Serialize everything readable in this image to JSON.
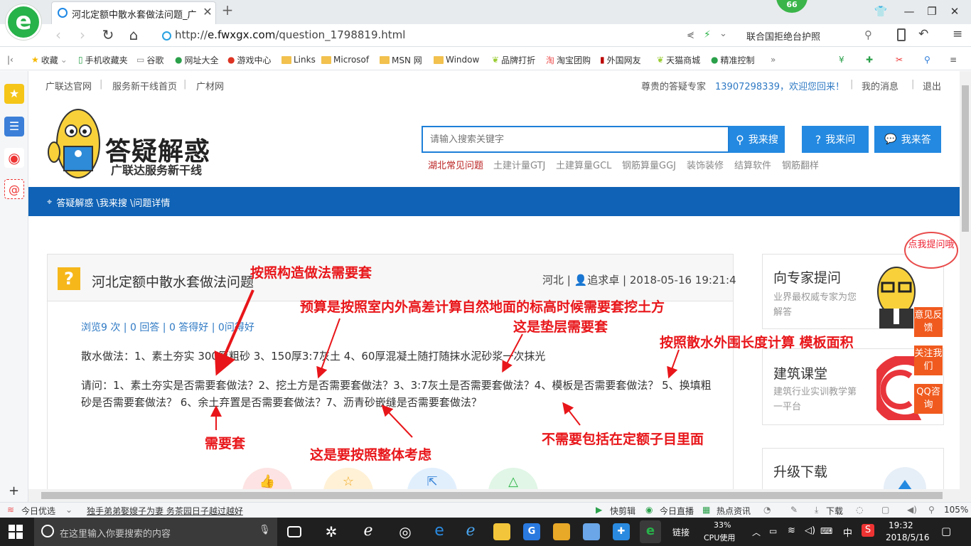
{
  "browser": {
    "tab_title": "河北定额中散水套做法问题_广联",
    "badge": "66",
    "url_prefix": "http://",
    "url_domain": "e.fwxgx.com",
    "url_path": "/question_1798819.html",
    "search_suggestion": "联合国拒绝台护照"
  },
  "bookmarks": [
    "收藏",
    "手机收藏夹",
    "谷歌",
    "网址大全",
    "游戏中心",
    "Links",
    "Microsof",
    "MSN 网",
    "Window",
    "品牌打折",
    "淘宝团购",
    "外国网友",
    "天猫商城",
    "精准控制"
  ],
  "site": {
    "top_links": [
      "广联达官网",
      "服务新干线首页",
      "广材网"
    ],
    "user_role": "尊贵的答疑专家",
    "user_phone": "13907298339，欢迎您回来！",
    "messages": "我的消息",
    "logout": "退出",
    "logo_title": "答疑解惑",
    "logo_subtitle": "广联达服务新干线",
    "search_placeholder": "请输入搜索关键字",
    "btn_search": "我来搜",
    "btn_ask": "我来问",
    "btn_answer": "我来答",
    "hot_keywords": [
      "湖北常见问题",
      "土建计量GTJ",
      "土建算量GCL",
      "钢筋算量GGJ",
      "装饰装修",
      "结算软件",
      "钢筋翻样"
    ],
    "breadcrumb": "答疑解惑 \\我来搜 \\问题详情"
  },
  "question": {
    "title": "河北定额中散水套做法问题",
    "meta": "河北 | 👤追求卓 | 2018-05-16 19:21:4",
    "stats": "浏览9 次 | 0 回答 | 0 答得好 | 0问得好",
    "body1": "散水做法：1、素土夯实        300厚粗砂  3、150厚3:7灰土 4、60厚混凝土随打随抹水泥砂浆一次抹光",
    "body2": "请问：1、素土夯实是否需要套做法？2、挖土方是否需要套做法？3、3:7灰土是否需要套做法？4、模板是否需要套做法？ 5、换填粗砂是否需要套做法？  6、余土弃置是否需要套做法？7、沥青砂嵌缝是否需要套做法？"
  },
  "right": {
    "expert_title": "向专家提问",
    "expert_sub": "业界最权威专家为您解答",
    "bubble": "点我提问哦",
    "class_title": "建筑课堂",
    "class_sub": "建筑行业实训教学第一平台",
    "download_title": "升级下载",
    "float_buttons": [
      "意见反馈",
      "关注我们",
      "QQ咨询"
    ]
  },
  "annotations": {
    "a1": "按照构造做法需要套",
    "a2": "预算是按照室内外高差计算自然地面的标高时候需要套挖土方",
    "a3": "这是垫层需要套",
    "a4": "按照散水外围长度计算 模板面积",
    "a5": "需要套",
    "a6": "这是要按照整体考虑",
    "a7": "不需要包括在定额子目里面"
  },
  "status": {
    "today": "今日优选",
    "headline": "独手弟弟娶嫂子为妻 务茶园日子越过越好",
    "items": [
      "快剪辑",
      "今日直播",
      "热点资讯",
      "下载"
    ],
    "zoom": "105%"
  },
  "taskbar": {
    "search_placeholder": "在这里输入你要搜索的内容",
    "link": "链接",
    "cpu": "33%",
    "cpu_label": "CPU使用",
    "ime": "中",
    "time": "19:32",
    "date": "2018/5/16"
  },
  "colors": {
    "accent": "#0f62b5",
    "button": "#2489e0",
    "annotation": "#e8161a",
    "float": "#f05a1e"
  }
}
